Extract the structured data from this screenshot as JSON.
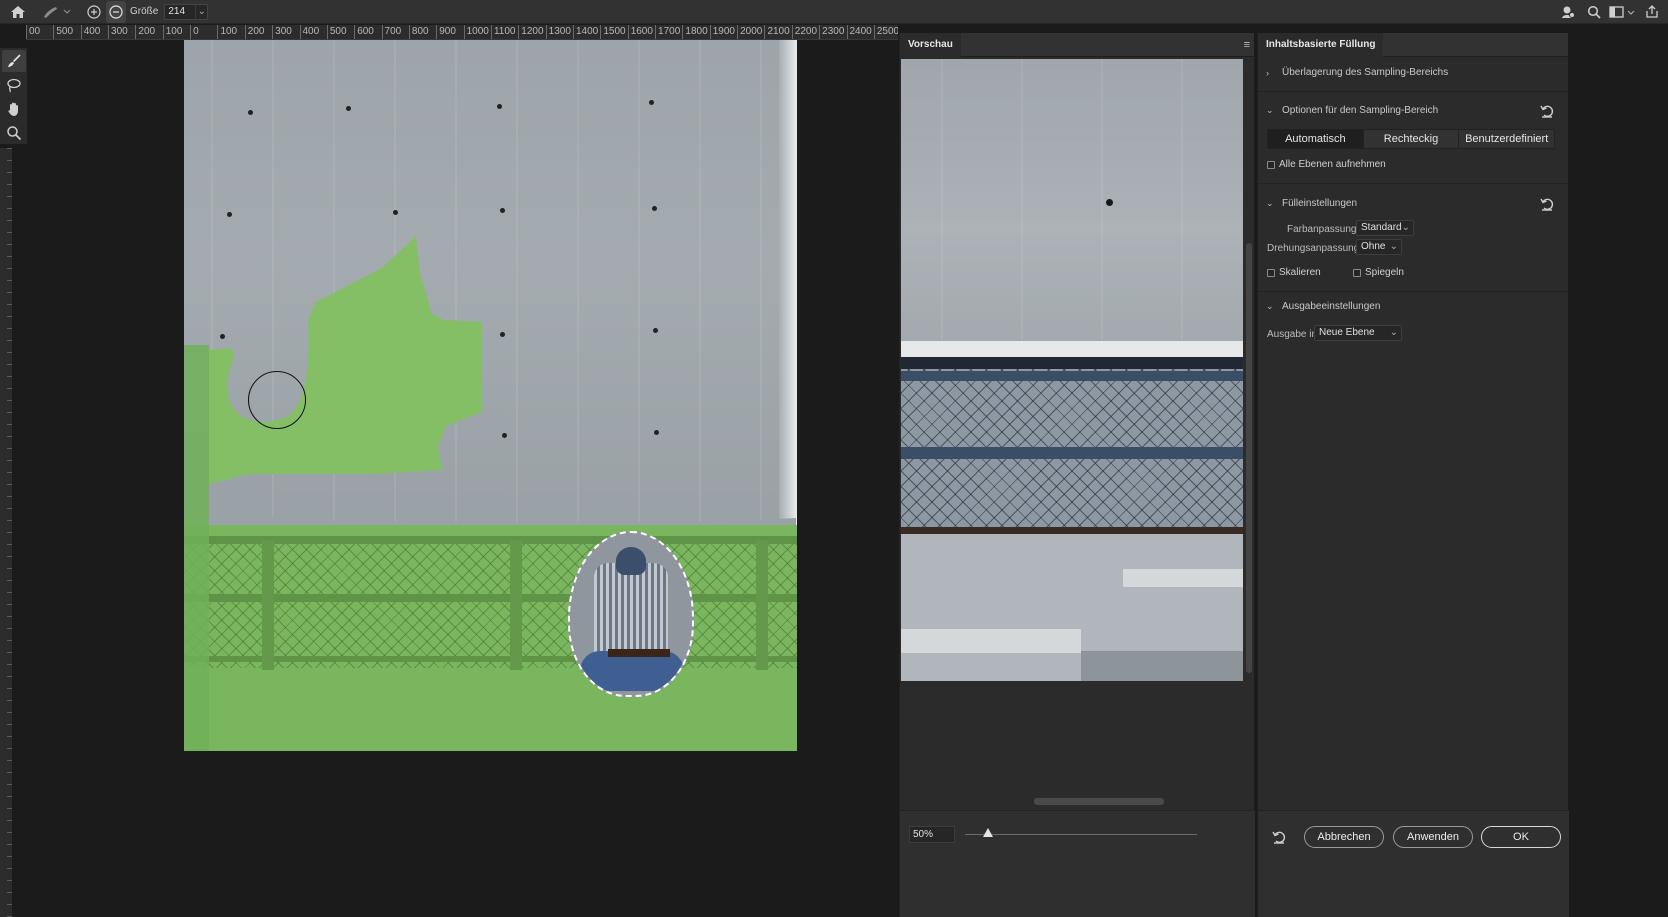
{
  "options_bar": {
    "size_label": "Größe",
    "size_value": "214",
    "brush_add_mode": "plus-circle-icon",
    "brush_subtract_mode": "minus-circle-icon"
  },
  "ruler": {
    "labels": [
      "00",
      "500",
      "400",
      "300",
      "200",
      "100",
      "0",
      "100",
      "200",
      "300",
      "400",
      "500",
      "600",
      "700",
      "800",
      "900",
      "1000",
      "1100",
      "1200",
      "1300",
      "1400",
      "1500",
      "1600",
      "1700",
      "1800",
      "1900",
      "2000",
      "2100",
      "2200",
      "2300",
      "2400",
      "2500"
    ]
  },
  "preview": {
    "tab_label": "Vorschau",
    "zoom_value": "50%",
    "zoom_level": 0.1
  },
  "properties": {
    "tab_label": "Inhaltsbasierte Füllung",
    "overlay_section": "Überlagerung des Sampling-Bereichs",
    "sampling_section": "Optionen für den Sampling-Bereich",
    "sampling_modes": [
      "Automatisch",
      "Rechteckig",
      "Benutzerdefiniert"
    ],
    "sampling_selected": "Automatisch",
    "all_layers": "Alle Ebenen aufnehmen",
    "fill_section": "Fülleinstellungen",
    "color_adapt_label": "Farbanpassung",
    "color_adapt_value": "Standard",
    "rotation_adapt_label": "Drehungsanpassung",
    "rotation_adapt_value": "Ohne",
    "scale_label": "Skalieren",
    "mirror_label": "Spiegeln",
    "output_section": "Ausgabeeinstellungen",
    "output_label": "Ausgabe in",
    "output_value": "Neue Ebene"
  },
  "actions": {
    "cancel": "Abbrechen",
    "apply": "Anwenden",
    "ok": "OK"
  },
  "colors": {
    "sampling_overlay": "#84be65",
    "panel_bg": "#2b2b2b",
    "app_bg": "#1b1b1b"
  }
}
